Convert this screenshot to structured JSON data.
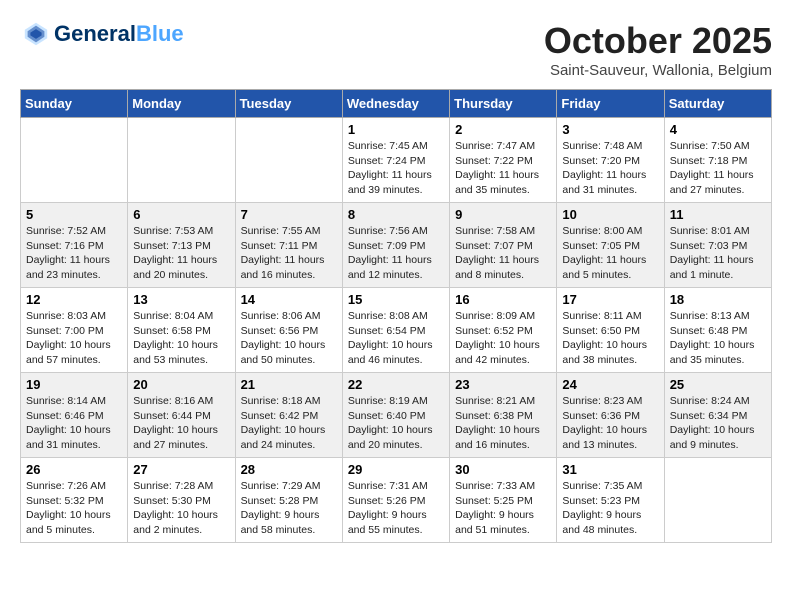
{
  "header": {
    "logo_line1": "General",
    "logo_line2": "Blue",
    "month": "October 2025",
    "location": "Saint-Sauveur, Wallonia, Belgium"
  },
  "weekdays": [
    "Sunday",
    "Monday",
    "Tuesday",
    "Wednesday",
    "Thursday",
    "Friday",
    "Saturday"
  ],
  "rows": [
    {
      "cells": [
        {
          "day": "",
          "content": ""
        },
        {
          "day": "",
          "content": ""
        },
        {
          "day": "",
          "content": ""
        },
        {
          "day": "1",
          "content": "Sunrise: 7:45 AM\nSunset: 7:24 PM\nDaylight: 11 hours\nand 39 minutes."
        },
        {
          "day": "2",
          "content": "Sunrise: 7:47 AM\nSunset: 7:22 PM\nDaylight: 11 hours\nand 35 minutes."
        },
        {
          "day": "3",
          "content": "Sunrise: 7:48 AM\nSunset: 7:20 PM\nDaylight: 11 hours\nand 31 minutes."
        },
        {
          "day": "4",
          "content": "Sunrise: 7:50 AM\nSunset: 7:18 PM\nDaylight: 11 hours\nand 27 minutes."
        }
      ],
      "shaded": false
    },
    {
      "cells": [
        {
          "day": "5",
          "content": "Sunrise: 7:52 AM\nSunset: 7:16 PM\nDaylight: 11 hours\nand 23 minutes."
        },
        {
          "day": "6",
          "content": "Sunrise: 7:53 AM\nSunset: 7:13 PM\nDaylight: 11 hours\nand 20 minutes."
        },
        {
          "day": "7",
          "content": "Sunrise: 7:55 AM\nSunset: 7:11 PM\nDaylight: 11 hours\nand 16 minutes."
        },
        {
          "day": "8",
          "content": "Sunrise: 7:56 AM\nSunset: 7:09 PM\nDaylight: 11 hours\nand 12 minutes."
        },
        {
          "day": "9",
          "content": "Sunrise: 7:58 AM\nSunset: 7:07 PM\nDaylight: 11 hours\nand 8 minutes."
        },
        {
          "day": "10",
          "content": "Sunrise: 8:00 AM\nSunset: 7:05 PM\nDaylight: 11 hours\nand 5 minutes."
        },
        {
          "day": "11",
          "content": "Sunrise: 8:01 AM\nSunset: 7:03 PM\nDaylight: 11 hours\nand 1 minute."
        }
      ],
      "shaded": true
    },
    {
      "cells": [
        {
          "day": "12",
          "content": "Sunrise: 8:03 AM\nSunset: 7:00 PM\nDaylight: 10 hours\nand 57 minutes."
        },
        {
          "day": "13",
          "content": "Sunrise: 8:04 AM\nSunset: 6:58 PM\nDaylight: 10 hours\nand 53 minutes."
        },
        {
          "day": "14",
          "content": "Sunrise: 8:06 AM\nSunset: 6:56 PM\nDaylight: 10 hours\nand 50 minutes."
        },
        {
          "day": "15",
          "content": "Sunrise: 8:08 AM\nSunset: 6:54 PM\nDaylight: 10 hours\nand 46 minutes."
        },
        {
          "day": "16",
          "content": "Sunrise: 8:09 AM\nSunset: 6:52 PM\nDaylight: 10 hours\nand 42 minutes."
        },
        {
          "day": "17",
          "content": "Sunrise: 8:11 AM\nSunset: 6:50 PM\nDaylight: 10 hours\nand 38 minutes."
        },
        {
          "day": "18",
          "content": "Sunrise: 8:13 AM\nSunset: 6:48 PM\nDaylight: 10 hours\nand 35 minutes."
        }
      ],
      "shaded": false
    },
    {
      "cells": [
        {
          "day": "19",
          "content": "Sunrise: 8:14 AM\nSunset: 6:46 PM\nDaylight: 10 hours\nand 31 minutes."
        },
        {
          "day": "20",
          "content": "Sunrise: 8:16 AM\nSunset: 6:44 PM\nDaylight: 10 hours\nand 27 minutes."
        },
        {
          "day": "21",
          "content": "Sunrise: 8:18 AM\nSunset: 6:42 PM\nDaylight: 10 hours\nand 24 minutes."
        },
        {
          "day": "22",
          "content": "Sunrise: 8:19 AM\nSunset: 6:40 PM\nDaylight: 10 hours\nand 20 minutes."
        },
        {
          "day": "23",
          "content": "Sunrise: 8:21 AM\nSunset: 6:38 PM\nDaylight: 10 hours\nand 16 minutes."
        },
        {
          "day": "24",
          "content": "Sunrise: 8:23 AM\nSunset: 6:36 PM\nDaylight: 10 hours\nand 13 minutes."
        },
        {
          "day": "25",
          "content": "Sunrise: 8:24 AM\nSunset: 6:34 PM\nDaylight: 10 hours\nand 9 minutes."
        }
      ],
      "shaded": true
    },
    {
      "cells": [
        {
          "day": "26",
          "content": "Sunrise: 7:26 AM\nSunset: 5:32 PM\nDaylight: 10 hours\nand 5 minutes."
        },
        {
          "day": "27",
          "content": "Sunrise: 7:28 AM\nSunset: 5:30 PM\nDaylight: 10 hours\nand 2 minutes."
        },
        {
          "day": "28",
          "content": "Sunrise: 7:29 AM\nSunset: 5:28 PM\nDaylight: 9 hours\nand 58 minutes."
        },
        {
          "day": "29",
          "content": "Sunrise: 7:31 AM\nSunset: 5:26 PM\nDaylight: 9 hours\nand 55 minutes."
        },
        {
          "day": "30",
          "content": "Sunrise: 7:33 AM\nSunset: 5:25 PM\nDaylight: 9 hours\nand 51 minutes."
        },
        {
          "day": "31",
          "content": "Sunrise: 7:35 AM\nSunset: 5:23 PM\nDaylight: 9 hours\nand 48 minutes."
        },
        {
          "day": "",
          "content": ""
        }
      ],
      "shaded": false
    }
  ]
}
